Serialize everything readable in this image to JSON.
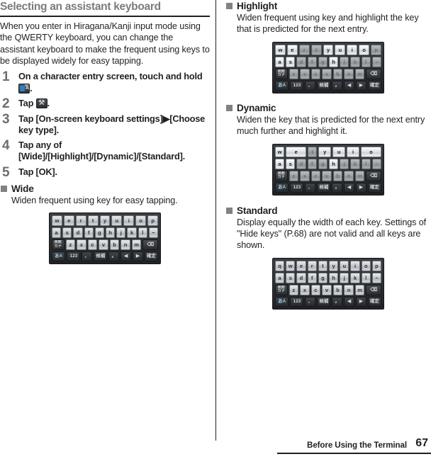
{
  "section": {
    "title": "Selecting an assistant keyboard",
    "intro": "When you enter in Hiragana/Kanji input mode using the QWERTY keyboard, you can change the assistant keyboard to make the frequent using keys to be displayed widely for easy tapping."
  },
  "steps": [
    {
      "num": "1",
      "text_before": "On a character entry screen, touch and hold ",
      "icon": "keyboard-switch-icon",
      "text_after": "."
    },
    {
      "num": "2",
      "text_before": "Tap ",
      "icon": "tool-settings-icon",
      "text_after": "."
    },
    {
      "num": "3",
      "text_before": "Tap [On-screen keyboard settings]▶[Choose key type].",
      "icon": "",
      "text_after": ""
    },
    {
      "num": "4",
      "text_before": "Tap any of [Wide]/[Highlight]/[Dynamic]/[Standard].",
      "icon": "",
      "text_after": ""
    },
    {
      "num": "5",
      "text_before": "Tap [OK].",
      "icon": "",
      "text_after": ""
    }
  ],
  "modes": {
    "wide": {
      "label": "Wide",
      "description": "Widen frequent using key for easy tapping."
    },
    "highlight": {
      "label": "Highlight",
      "description": "Widen frequent using key and highlight the key that is predicted for the next entry."
    },
    "dynamic": {
      "label": "Dynamic",
      "description": "Widen the key that is predicted for the next entry much further and highlight it."
    },
    "standard": {
      "label": "Standard",
      "description": "Display equally the width of each key. Settings of \"Hide keys\" (P.68) are not valid and all keys are shown."
    }
  },
  "keyboards": {
    "wide": {
      "rows": [
        [
          {
            "cap": "w",
            "style": "normal",
            "w": "w10"
          },
          {
            "cap": "e",
            "style": "normal",
            "w": "w10"
          },
          {
            "cap": "r",
            "style": "normal",
            "w": "w10"
          },
          {
            "cap": "t",
            "style": "normal",
            "w": "w10"
          },
          {
            "cap": "y",
            "style": "normal",
            "w": "w10"
          },
          {
            "cap": "u",
            "style": "normal",
            "w": "w10"
          },
          {
            "cap": "i",
            "style": "normal",
            "w": "w10"
          },
          {
            "cap": "o",
            "style": "normal",
            "w": "w10"
          },
          {
            "cap": "p",
            "style": "normal",
            "w": "w10"
          }
        ],
        [
          {
            "cap": "a",
            "style": "normal",
            "w": "w10"
          },
          {
            "cap": "s",
            "style": "normal",
            "w": "w10"
          },
          {
            "cap": "d",
            "style": "normal",
            "w": "w10"
          },
          {
            "cap": "f",
            "style": "normal",
            "w": "w10"
          },
          {
            "cap": "g",
            "style": "normal",
            "w": "w10"
          },
          {
            "cap": "h",
            "style": "normal",
            "w": "w10"
          },
          {
            "cap": "j",
            "style": "normal",
            "w": "w10"
          },
          {
            "cap": "k",
            "style": "normal",
            "w": "w10"
          },
          {
            "cap": "l",
            "style": "normal",
            "w": "w10"
          },
          {
            "cap": "−",
            "style": "normal",
            "w": "w10"
          }
        ],
        [
          {
            "cap": "英数\nカナ",
            "style": "fn",
            "w": "w13"
          },
          {
            "cap": "z",
            "style": "normal",
            "w": "w10"
          },
          {
            "cap": "x",
            "style": "normal",
            "w": "w10"
          },
          {
            "cap": "c",
            "style": "normal",
            "w": "w10"
          },
          {
            "cap": "v",
            "style": "normal",
            "w": "w10"
          },
          {
            "cap": "b",
            "style": "normal",
            "w": "w10"
          },
          {
            "cap": "n",
            "style": "normal",
            "w": "w10"
          },
          {
            "cap": "m",
            "style": "normal",
            "w": "w10"
          },
          {
            "cap": "⌫",
            "style": "del",
            "w": "w16"
          }
        ],
        [
          {
            "cap": "あA",
            "style": "ime",
            "w": "w13"
          },
          {
            "cap": "123",
            "style": "bottom",
            "w": "w13"
          },
          {
            "cap": "、",
            "style": "bottom",
            "w": "w10"
          },
          {
            "cap": "候補",
            "style": "bottom",
            "w": "w13"
          },
          {
            "cap": "。",
            "style": "bottom",
            "w": "w10"
          },
          {
            "cap": "◀",
            "style": "bottom",
            "w": "w10"
          },
          {
            "cap": "▶",
            "style": "bottom",
            "w": "w10"
          },
          {
            "cap": "確定",
            "style": "bottom",
            "w": "w13"
          }
        ]
      ]
    },
    "highlight": {
      "rows": [
        [
          {
            "cap": "w",
            "style": "hot",
            "w": "w10"
          },
          {
            "cap": "e",
            "style": "hot",
            "w": "w10"
          },
          {
            "cap": "r",
            "style": "dim",
            "w": "w10"
          },
          {
            "cap": "t",
            "style": "dim",
            "w": "w10"
          },
          {
            "cap": "y",
            "style": "hot",
            "w": "w10"
          },
          {
            "cap": "u",
            "style": "hot",
            "w": "w10"
          },
          {
            "cap": "i",
            "style": "hot",
            "w": "w10"
          },
          {
            "cap": "o",
            "style": "hot",
            "w": "w10"
          },
          {
            "cap": "p",
            "style": "dim",
            "w": "w10"
          }
        ],
        [
          {
            "cap": "a",
            "style": "hot",
            "w": "w10"
          },
          {
            "cap": "s",
            "style": "hot",
            "w": "w10"
          },
          {
            "cap": "d",
            "style": "dim",
            "w": "w10"
          },
          {
            "cap": "f",
            "style": "dim",
            "w": "w10"
          },
          {
            "cap": "g",
            "style": "dim",
            "w": "w10"
          },
          {
            "cap": "h",
            "style": "hot",
            "w": "w10"
          },
          {
            "cap": "j",
            "style": "dim",
            "w": "w10"
          },
          {
            "cap": "k",
            "style": "dim",
            "w": "w10"
          },
          {
            "cap": "l",
            "style": "dim",
            "w": "w10"
          },
          {
            "cap": "−",
            "style": "dim",
            "w": "w10"
          }
        ],
        [
          {
            "cap": "英数\nカナ",
            "style": "fn",
            "w": "w13"
          },
          {
            "cap": "z",
            "style": "dim",
            "w": "w10"
          },
          {
            "cap": "x",
            "style": "dim",
            "w": "w10"
          },
          {
            "cap": "c",
            "style": "dim",
            "w": "w10"
          },
          {
            "cap": "v",
            "style": "dim",
            "w": "w10"
          },
          {
            "cap": "b",
            "style": "dim",
            "w": "w10"
          },
          {
            "cap": "n",
            "style": "dim",
            "w": "w10"
          },
          {
            "cap": "m",
            "style": "dim",
            "w": "w10"
          },
          {
            "cap": "⌫",
            "style": "del",
            "w": "w16"
          }
        ],
        [
          {
            "cap": "あA",
            "style": "ime",
            "w": "w13"
          },
          {
            "cap": "123",
            "style": "bottom",
            "w": "w13"
          },
          {
            "cap": "、",
            "style": "bottom",
            "w": "w10"
          },
          {
            "cap": "候補",
            "style": "bottom",
            "w": "w13"
          },
          {
            "cap": "。",
            "style": "bottom",
            "w": "w10"
          },
          {
            "cap": "◀",
            "style": "bottom",
            "w": "w10"
          },
          {
            "cap": "▶",
            "style": "bottom",
            "w": "w10"
          },
          {
            "cap": "確定",
            "style": "bottom",
            "w": "w13"
          }
        ]
      ]
    },
    "dynamic": {
      "rows": [
        [
          {
            "cap": "w",
            "style": "hot",
            "w": "w07"
          },
          {
            "cap": "e",
            "style": "hot",
            "w": "w16"
          },
          {
            "cap": "t",
            "style": "dim",
            "w": "w07"
          },
          {
            "cap": "y",
            "style": "hot",
            "w": "w10"
          },
          {
            "cap": "u",
            "style": "hot",
            "w": "w10"
          },
          {
            "cap": "i",
            "style": "hot",
            "w": "w10"
          },
          {
            "cap": "o",
            "style": "hot",
            "w": "w16"
          }
        ],
        [
          {
            "cap": "a",
            "style": "hot",
            "w": "w10"
          },
          {
            "cap": "s",
            "style": "hot",
            "w": "w10"
          },
          {
            "cap": "d",
            "style": "dim",
            "w": "w10"
          },
          {
            "cap": "f",
            "style": "dim",
            "w": "w10"
          },
          {
            "cap": "g",
            "style": "dim",
            "w": "w10"
          },
          {
            "cap": "h",
            "style": "hot",
            "w": "w10"
          },
          {
            "cap": "j",
            "style": "dim",
            "w": "w10"
          },
          {
            "cap": "k",
            "style": "dim",
            "w": "w10"
          },
          {
            "cap": "l",
            "style": "dim",
            "w": "w10"
          },
          {
            "cap": "−",
            "style": "dim",
            "w": "w10"
          }
        ],
        [
          {
            "cap": "英数\nカナ",
            "style": "fn",
            "w": "w13"
          },
          {
            "cap": "z",
            "style": "dim",
            "w": "w10"
          },
          {
            "cap": "x",
            "style": "dim",
            "w": "w10"
          },
          {
            "cap": "c",
            "style": "dim",
            "w": "w10"
          },
          {
            "cap": "v",
            "style": "dim",
            "w": "w10"
          },
          {
            "cap": "b",
            "style": "dim",
            "w": "w10"
          },
          {
            "cap": "n",
            "style": "dim",
            "w": "w10"
          },
          {
            "cap": "m",
            "style": "dim",
            "w": "w10"
          },
          {
            "cap": "⌫",
            "style": "del",
            "w": "w16"
          }
        ],
        [
          {
            "cap": "あA",
            "style": "ime",
            "w": "w13"
          },
          {
            "cap": "123",
            "style": "bottom",
            "w": "w13"
          },
          {
            "cap": "、",
            "style": "bottom",
            "w": "w10"
          },
          {
            "cap": "候補",
            "style": "bottom",
            "w": "w13"
          },
          {
            "cap": "。",
            "style": "bottom",
            "w": "w10"
          },
          {
            "cap": "◀",
            "style": "bottom",
            "w": "w10"
          },
          {
            "cap": "▶",
            "style": "bottom",
            "w": "w10"
          },
          {
            "cap": "確定",
            "style": "bottom",
            "w": "w13"
          }
        ]
      ]
    },
    "standard": {
      "rows": [
        [
          {
            "cap": "q",
            "style": "normal",
            "w": "w10"
          },
          {
            "cap": "w",
            "style": "normal",
            "w": "w10"
          },
          {
            "cap": "e",
            "style": "normal",
            "w": "w10"
          },
          {
            "cap": "r",
            "style": "normal",
            "w": "w10"
          },
          {
            "cap": "t",
            "style": "normal",
            "w": "w10"
          },
          {
            "cap": "y",
            "style": "normal",
            "w": "w10"
          },
          {
            "cap": "u",
            "style": "normal",
            "w": "w10"
          },
          {
            "cap": "i",
            "style": "normal",
            "w": "w10"
          },
          {
            "cap": "o",
            "style": "normal",
            "w": "w10"
          },
          {
            "cap": "p",
            "style": "normal",
            "w": "w10"
          }
        ],
        [
          {
            "cap": "a",
            "style": "normal",
            "w": "w10"
          },
          {
            "cap": "s",
            "style": "normal",
            "w": "w10"
          },
          {
            "cap": "d",
            "style": "normal",
            "w": "w10"
          },
          {
            "cap": "f",
            "style": "normal",
            "w": "w10"
          },
          {
            "cap": "g",
            "style": "normal",
            "w": "w10"
          },
          {
            "cap": "h",
            "style": "normal",
            "w": "w10"
          },
          {
            "cap": "j",
            "style": "normal",
            "w": "w10"
          },
          {
            "cap": "k",
            "style": "normal",
            "w": "w10"
          },
          {
            "cap": "l",
            "style": "normal",
            "w": "w10"
          },
          {
            "cap": "−",
            "style": "normal",
            "w": "w10"
          }
        ],
        [
          {
            "cap": "英数\nカナ",
            "style": "fn",
            "w": "w13"
          },
          {
            "cap": "z",
            "style": "normal",
            "w": "w10"
          },
          {
            "cap": "x",
            "style": "normal",
            "w": "w10"
          },
          {
            "cap": "c",
            "style": "normal",
            "w": "w10"
          },
          {
            "cap": "v",
            "style": "normal",
            "w": "w10"
          },
          {
            "cap": "b",
            "style": "normal",
            "w": "w10"
          },
          {
            "cap": "n",
            "style": "normal",
            "w": "w10"
          },
          {
            "cap": "m",
            "style": "normal",
            "w": "w10"
          },
          {
            "cap": "⌫",
            "style": "del",
            "w": "w16"
          }
        ],
        [
          {
            "cap": "あA",
            "style": "ime",
            "w": "w13"
          },
          {
            "cap": "123",
            "style": "bottom",
            "w": "w13"
          },
          {
            "cap": "、",
            "style": "bottom",
            "w": "w10"
          },
          {
            "cap": "候補",
            "style": "bottom",
            "w": "w13"
          },
          {
            "cap": "。",
            "style": "bottom",
            "w": "w10"
          },
          {
            "cap": "◀",
            "style": "bottom",
            "w": "w10"
          },
          {
            "cap": "▶",
            "style": "bottom",
            "w": "w10"
          },
          {
            "cap": "確定",
            "style": "bottom",
            "w": "w13"
          }
        ]
      ]
    }
  },
  "footer": {
    "chapter": "Before Using the Terminal",
    "page": "67"
  }
}
